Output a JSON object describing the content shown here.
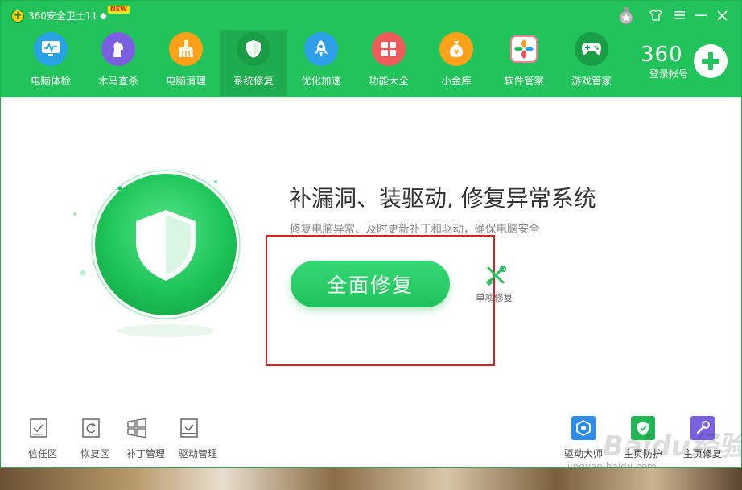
{
  "app": {
    "title": "360安全卫士11",
    "new_badge": "NEW"
  },
  "window_controls": {
    "skin": "shirt-icon",
    "menu": "menu-icon",
    "minimize": "minimize-icon",
    "close": "close-icon"
  },
  "nav": {
    "items": [
      {
        "label": "电脑体检",
        "icon": "monitor-icon",
        "color": "#27a3e5"
      },
      {
        "label": "木马查杀",
        "icon": "horse-icon",
        "color": "#7b5fe0"
      },
      {
        "label": "电脑清理",
        "icon": "broom-icon",
        "color": "#ffa21a"
      },
      {
        "label": "系统修复",
        "icon": "shield-icon",
        "color": "#1a9d47"
      },
      {
        "label": "优化加速",
        "icon": "rocket-icon",
        "color": "#2e9fe8"
      },
      {
        "label": "功能大全",
        "icon": "grid-icon",
        "color": "#f05a5a"
      },
      {
        "label": "小金库",
        "icon": "moneybag-icon",
        "color": "#ffa21a"
      },
      {
        "label": "软件管家",
        "icon": "flower-icon",
        "color": "#ffffff"
      },
      {
        "label": "游戏管家",
        "icon": "gamepad-icon",
        "color": "#1a9d47"
      }
    ],
    "active_index": 3
  },
  "account": {
    "brand": "360",
    "label": "登录帐号"
  },
  "main": {
    "headline": "补漏洞、装驱动, 修复异常系统",
    "subline": "修复电脑异常、及时更新补丁和驱动，确保电脑安全",
    "primary_button": "全面修复",
    "secondary_action": "单项修复"
  },
  "bottom_tools": [
    {
      "label": "信任区",
      "icon": "trust-zone-icon"
    },
    {
      "label": "恢复区",
      "icon": "restore-zone-icon"
    },
    {
      "label": "补丁管理",
      "icon": "windows-icon"
    },
    {
      "label": "驱动管理",
      "icon": "driver-manage-icon"
    }
  ],
  "right_tools": [
    {
      "label": "驱动大师",
      "icon": "driver-master-icon",
      "color": "#2e8de8"
    },
    {
      "label": "主页防护",
      "icon": "homepage-protect-icon",
      "color": "#22b655"
    },
    {
      "label": "主页修复",
      "icon": "homepage-repair-icon",
      "color": "#7b5fe0"
    }
  ],
  "watermark": {
    "text": "Baidu经验",
    "sub": "jingyan.baidu.com"
  },
  "colors": {
    "brand_green": "#22c35a",
    "active_tab": "#1eac4f",
    "highlight_box": "#e02020"
  }
}
